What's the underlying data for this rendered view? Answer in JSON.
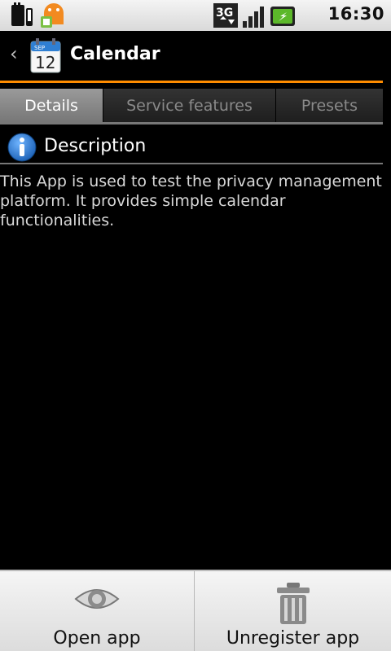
{
  "status_bar": {
    "time": "16:30",
    "network_label": "3G",
    "icons": [
      "sd-card-icon",
      "android-debug-icon",
      "3g-data-icon",
      "signal-icon",
      "battery-charging-icon"
    ]
  },
  "header": {
    "title": "Calendar",
    "calendar_icon_month": "SEP",
    "calendar_icon_day": "12",
    "accent_color": "#ff8c00"
  },
  "tabs": [
    {
      "label": "Details",
      "active": true
    },
    {
      "label": "Service features",
      "active": false
    },
    {
      "label": "Presets",
      "active": false
    }
  ],
  "section": {
    "title": "Description",
    "text": "This App is used to test the privacy management platform. It provides simple calendar functionalities."
  },
  "bottom_bar": {
    "open_label": "Open app",
    "unregister_label": "Unregister app"
  }
}
